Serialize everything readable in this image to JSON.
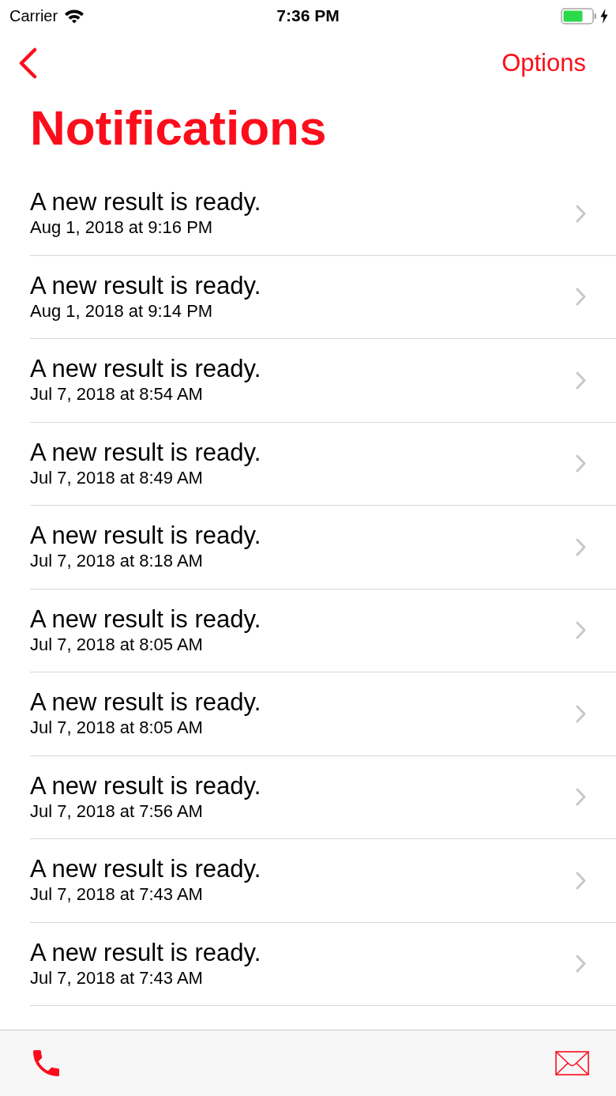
{
  "status_bar": {
    "carrier": "Carrier",
    "time": "7:36 PM",
    "charging": true
  },
  "nav_bar": {
    "action": "Options"
  },
  "title": "Notifications",
  "notifications": [
    {
      "message": "A new result is ready.",
      "date": "Aug 1, 2018 at 9:16 PM"
    },
    {
      "message": "A new result is ready.",
      "date": "Aug 1, 2018 at 9:14 PM"
    },
    {
      "message": "A new result is ready.",
      "date": "Jul 7, 2018 at 8:54 AM"
    },
    {
      "message": "A new result is ready.",
      "date": "Jul 7, 2018 at 8:49 AM"
    },
    {
      "message": "A new result is ready.",
      "date": "Jul 7, 2018 at 8:18 AM"
    },
    {
      "message": "A new result is ready.",
      "date": "Jul 7, 2018 at 8:05 AM"
    },
    {
      "message": "A new result is ready.",
      "date": "Jul 7, 2018 at 8:05 AM"
    },
    {
      "message": "A new result is ready.",
      "date": "Jul 7, 2018 at 7:56 AM"
    },
    {
      "message": "A new result is ready.",
      "date": "Jul 7, 2018 at 7:43 AM"
    },
    {
      "message": "A new result is ready.",
      "date": "Jul 7, 2018 at 7:43 AM"
    }
  ]
}
